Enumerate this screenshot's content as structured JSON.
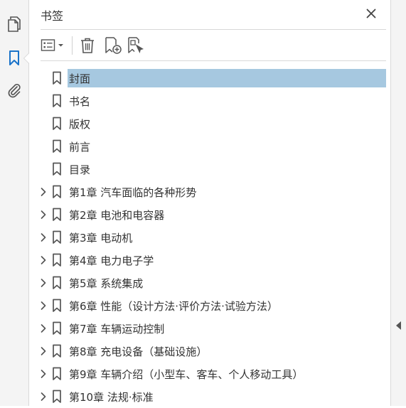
{
  "panel": {
    "title": "书签",
    "close_icon": "close-icon"
  },
  "left_rail": {
    "items": [
      {
        "name": "pages",
        "icon": "page-thumbnails-icon",
        "active": false
      },
      {
        "name": "bookmarks",
        "icon": "bookmark-icon",
        "active": true
      },
      {
        "name": "attachments",
        "icon": "paperclip-icon",
        "active": false
      }
    ],
    "active_color": "#1a73c9"
  },
  "toolbar": {
    "options_icon": "options-menu-icon",
    "delete_icon": "trash-icon",
    "new_bookmark_icon": "add-bookmark-icon",
    "new_from_structure_icon": "bookmark-from-structure-icon"
  },
  "bookmarks": [
    {
      "label": "封面",
      "expandable": false,
      "selected": true
    },
    {
      "label": "书名",
      "expandable": false,
      "selected": false
    },
    {
      "label": "版权",
      "expandable": false,
      "selected": false
    },
    {
      "label": "前言",
      "expandable": false,
      "selected": false
    },
    {
      "label": "目录",
      "expandable": false,
      "selected": false
    },
    {
      "label": "第1章  汽车面临的各种形势",
      "expandable": true,
      "selected": false
    },
    {
      "label": "第2章  电池和电容器",
      "expandable": true,
      "selected": false
    },
    {
      "label": "第3章  电动机",
      "expandable": true,
      "selected": false
    },
    {
      "label": "第4章  电力电子学",
      "expandable": true,
      "selected": false
    },
    {
      "label": "第5章  系统集成",
      "expandable": true,
      "selected": false
    },
    {
      "label": "第6章  性能（设计方法·评价方法·试验方法）",
      "expandable": true,
      "selected": false
    },
    {
      "label": "第7章  车辆运动控制",
      "expandable": true,
      "selected": false
    },
    {
      "label": "第8章  充电设备（基础设施）",
      "expandable": true,
      "selected": false
    },
    {
      "label": "第9章  车辆介绍（小型车、客车、个人移动工具）",
      "expandable": true,
      "selected": false
    },
    {
      "label": "第10章  法规·标准",
      "expandable": true,
      "selected": false
    }
  ],
  "colors": {
    "selected_bg": "#a6c8e0",
    "icon": "#555555",
    "text": "#333333"
  }
}
